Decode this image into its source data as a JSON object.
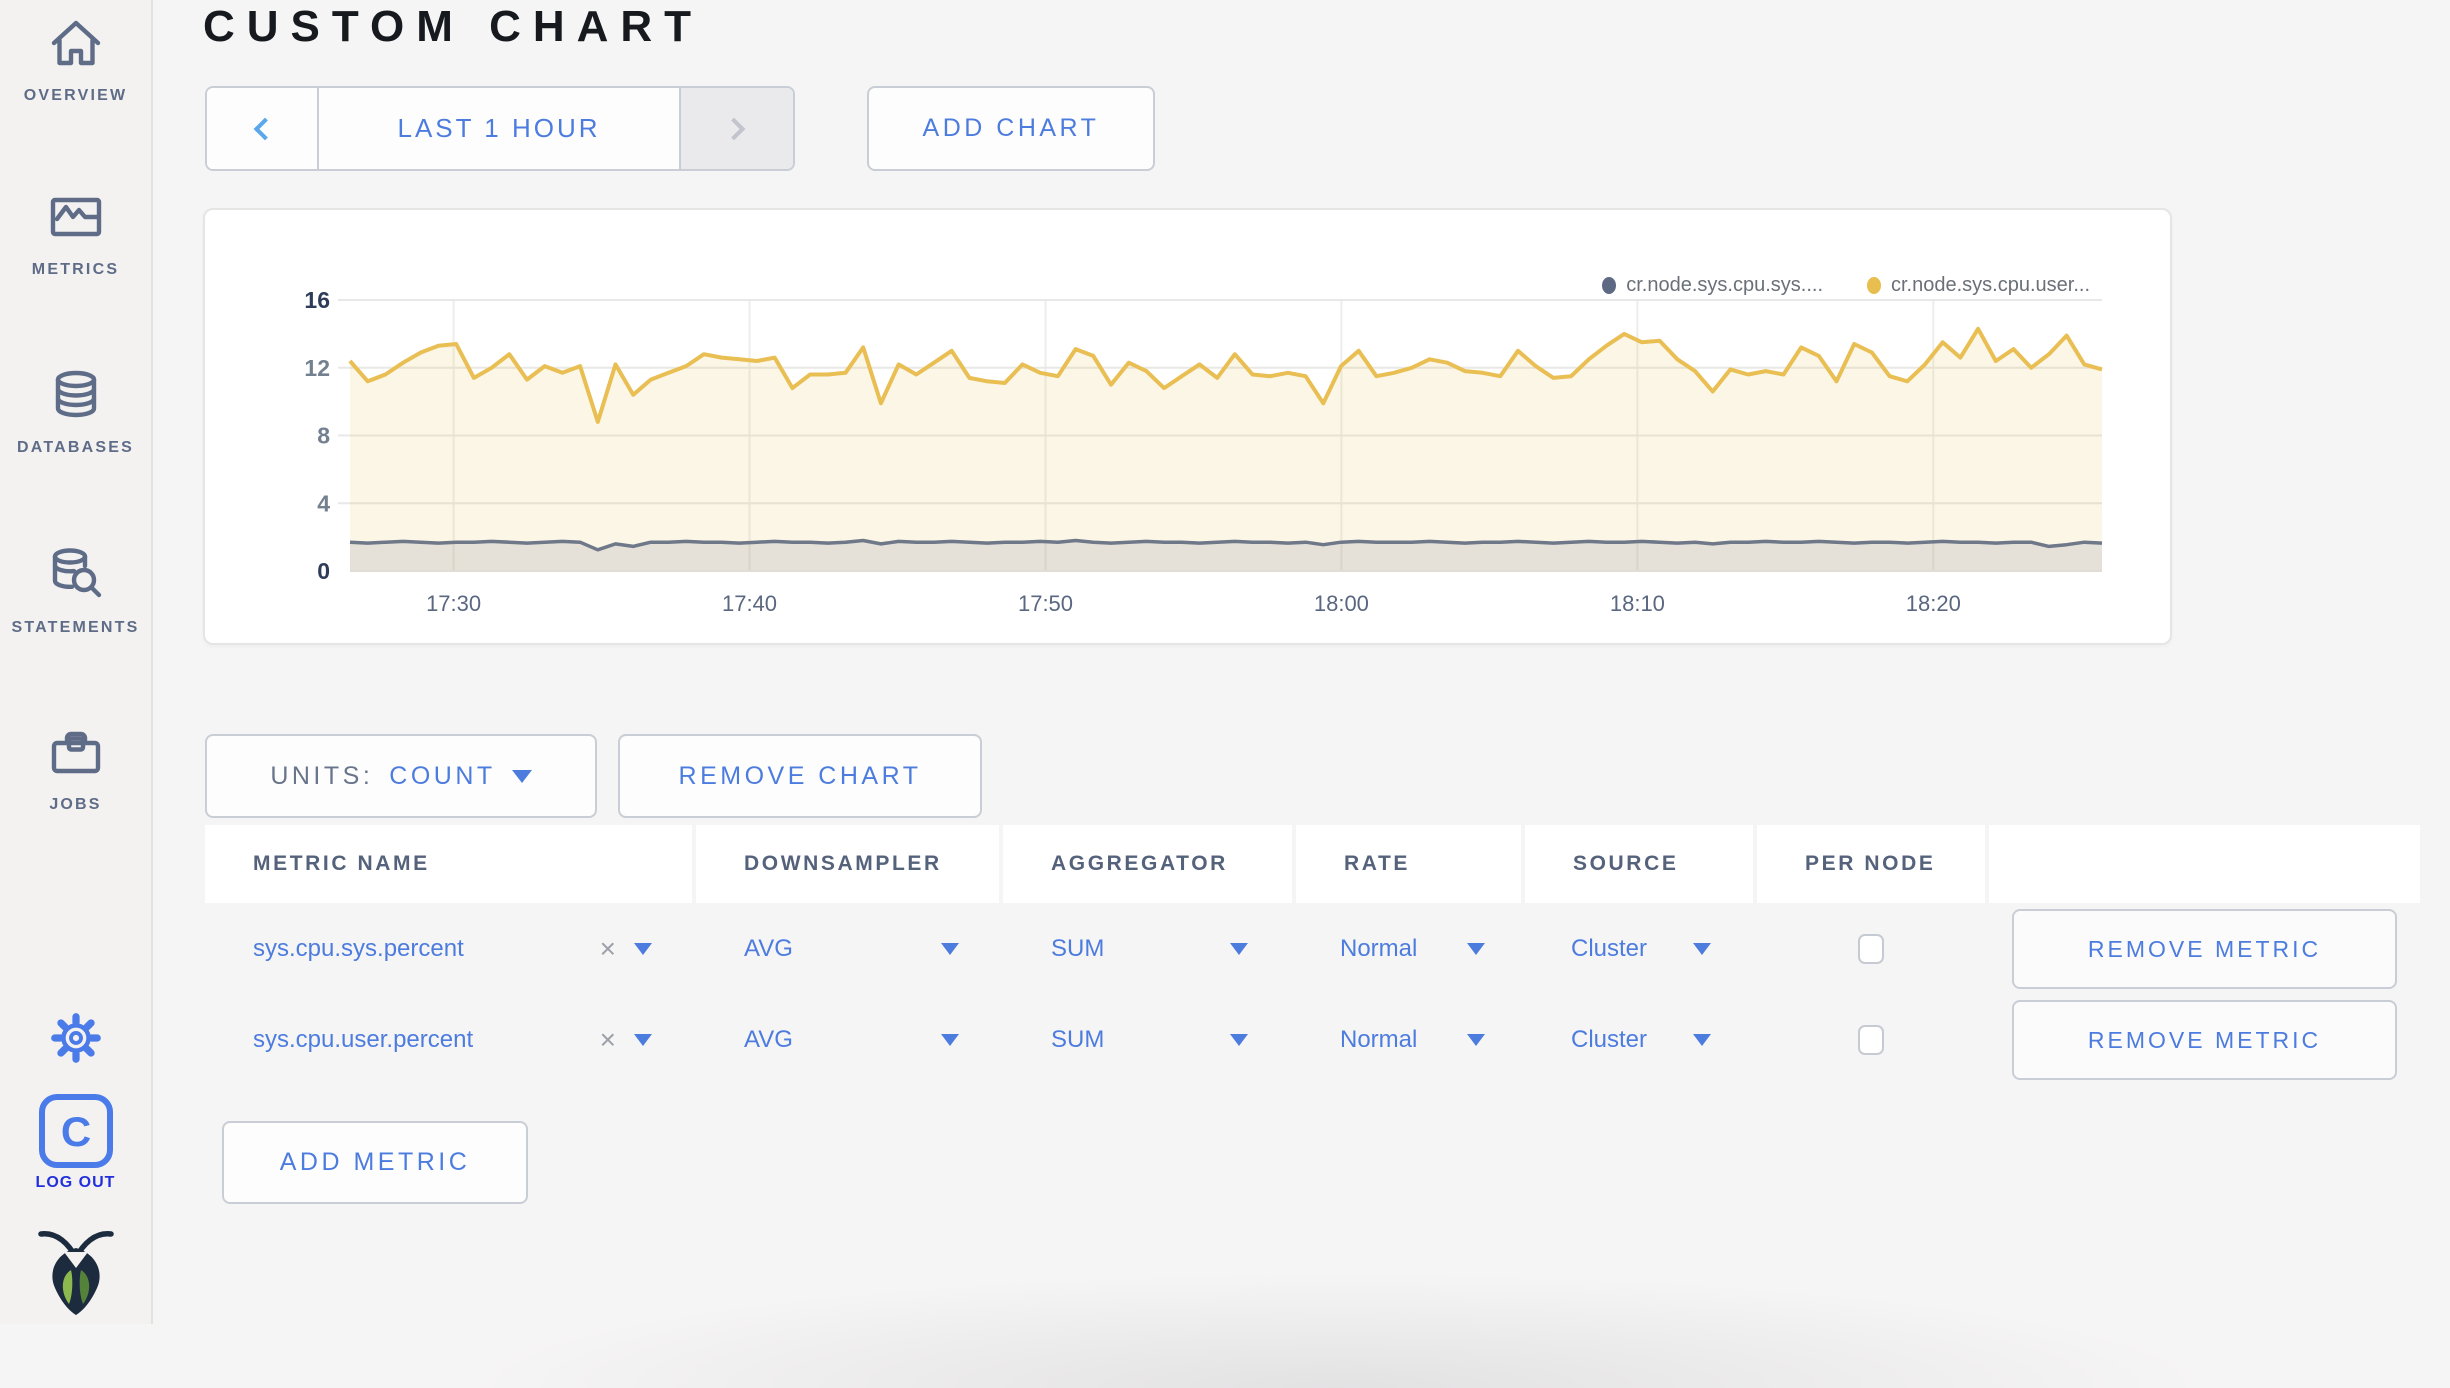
{
  "header": {
    "title": "CUSTOM CHART"
  },
  "toolbar": {
    "time_range_label": "LAST 1 HOUR",
    "add_chart_label": "ADD CHART"
  },
  "chart_controls": {
    "units_label": "UNITS:",
    "units_value": "COUNT",
    "remove_chart_label": "REMOVE CHART",
    "add_metric_label": "ADD METRIC"
  },
  "icons": {
    "close": "×"
  },
  "sidebar": {
    "items": [
      {
        "label": "OVERVIEW",
        "icon": "home-icon"
      },
      {
        "label": "METRICS",
        "icon": "metrics-icon"
      },
      {
        "label": "DATABASES",
        "icon": "database-icon"
      },
      {
        "label": "STATEMENTS",
        "icon": "statements-icon"
      },
      {
        "label": "JOBS",
        "icon": "briefcase-icon"
      }
    ],
    "logout_label": "LOG OUT"
  },
  "chart_data": {
    "type": "area",
    "title": "",
    "xlabel": "",
    "ylabel": "",
    "ylim": [
      0,
      16
    ],
    "y_ticks": [
      0,
      4,
      8,
      12,
      16
    ],
    "x_ticks": [
      "17:30",
      "17:40",
      "17:50",
      "18:00",
      "18:10",
      "18:20"
    ],
    "x_tick_minutes": [
      30,
      40,
      50,
      60,
      70,
      80
    ],
    "x_domain_minutes": [
      26.5,
      85.7
    ],
    "grid": true,
    "legend_position": "top-right",
    "legend": [
      {
        "label": "cr.node.sys.cpu.sys....",
        "color": "#5E6A84"
      },
      {
        "label": "cr.node.sys.cpu.user...",
        "color": "#E8BE4F"
      }
    ],
    "series": [
      {
        "name": "cr.node.sys.cpu.user...",
        "color": "#E9BE53",
        "fill": "rgba(233,190,83,0.14)",
        "line_width": 4,
        "values": [
          12.4,
          11.2,
          11.6,
          12.3,
          12.9,
          13.3,
          13.4,
          11.4,
          12.0,
          12.8,
          11.3,
          12.1,
          11.7,
          12.1,
          8.8,
          12.2,
          10.4,
          11.3,
          11.7,
          12.1,
          12.8,
          12.6,
          12.5,
          12.4,
          12.6,
          10.8,
          11.6,
          11.6,
          11.7,
          13.2,
          9.9,
          12.2,
          11.6,
          12.3,
          13.0,
          11.4,
          11.2,
          11.1,
          12.2,
          11.7,
          11.5,
          13.1,
          12.7,
          11.0,
          12.3,
          11.8,
          10.8,
          11.5,
          12.2,
          11.4,
          12.8,
          11.6,
          11.5,
          11.7,
          11.5,
          9.9,
          12.1,
          13.0,
          11.5,
          11.7,
          12.0,
          12.5,
          12.3,
          11.8,
          11.7,
          11.5,
          13.0,
          12.1,
          11.4,
          11.5,
          12.5,
          13.3,
          14.0,
          13.5,
          13.6,
          12.5,
          11.8,
          10.6,
          11.9,
          11.6,
          11.8,
          11.6,
          13.2,
          12.7,
          11.2,
          13.4,
          12.9,
          11.5,
          11.2,
          12.2,
          13.5,
          12.6,
          14.3,
          12.4,
          13.1,
          12.0,
          12.8,
          13.9,
          12.2,
          11.9
        ]
      },
      {
        "name": "cr.node.sys.cpu.sys....",
        "color": "#6F7889",
        "fill": "rgba(111,120,137,0.16)",
        "line_width": 3.5,
        "values": [
          1.7,
          1.65,
          1.7,
          1.75,
          1.7,
          1.65,
          1.7,
          1.7,
          1.75,
          1.7,
          1.65,
          1.7,
          1.75,
          1.7,
          1.25,
          1.6,
          1.45,
          1.7,
          1.7,
          1.75,
          1.7,
          1.7,
          1.65,
          1.7,
          1.75,
          1.7,
          1.7,
          1.65,
          1.7,
          1.8,
          1.6,
          1.75,
          1.7,
          1.7,
          1.75,
          1.7,
          1.65,
          1.7,
          1.7,
          1.75,
          1.7,
          1.8,
          1.7,
          1.65,
          1.7,
          1.75,
          1.7,
          1.7,
          1.65,
          1.7,
          1.75,
          1.7,
          1.7,
          1.65,
          1.7,
          1.55,
          1.7,
          1.75,
          1.7,
          1.7,
          1.7,
          1.75,
          1.7,
          1.65,
          1.7,
          1.7,
          1.75,
          1.7,
          1.65,
          1.7,
          1.75,
          1.7,
          1.7,
          1.75,
          1.7,
          1.65,
          1.7,
          1.6,
          1.7,
          1.7,
          1.75,
          1.7,
          1.7,
          1.75,
          1.7,
          1.65,
          1.7,
          1.7,
          1.65,
          1.7,
          1.75,
          1.7,
          1.7,
          1.65,
          1.7,
          1.7,
          1.45,
          1.55,
          1.7,
          1.65
        ]
      }
    ]
  },
  "metrics_table": {
    "headers": [
      "METRIC NAME",
      "DOWNSAMPLER",
      "AGGREGATOR",
      "RATE",
      "SOURCE",
      "PER NODE",
      ""
    ],
    "rows": [
      {
        "metric_name": "sys.cpu.sys.percent",
        "downsampler": "AVG",
        "aggregator": "SUM",
        "rate": "Normal",
        "source": "Cluster",
        "per_node_checked": false,
        "remove_label": "REMOVE METRIC"
      },
      {
        "metric_name": "sys.cpu.user.percent",
        "downsampler": "AVG",
        "aggregator": "SUM",
        "rate": "Normal",
        "source": "Cluster",
        "per_node_checked": false,
        "remove_label": "REMOVE METRIC"
      }
    ]
  },
  "colors": {
    "accent_blue": "#4D7CDF",
    "slate": "#5F6C87",
    "logout_blue": "#2230DB",
    "series_user_yellow": "#E9BE53",
    "series_sys_gray": "#6F7889"
  }
}
